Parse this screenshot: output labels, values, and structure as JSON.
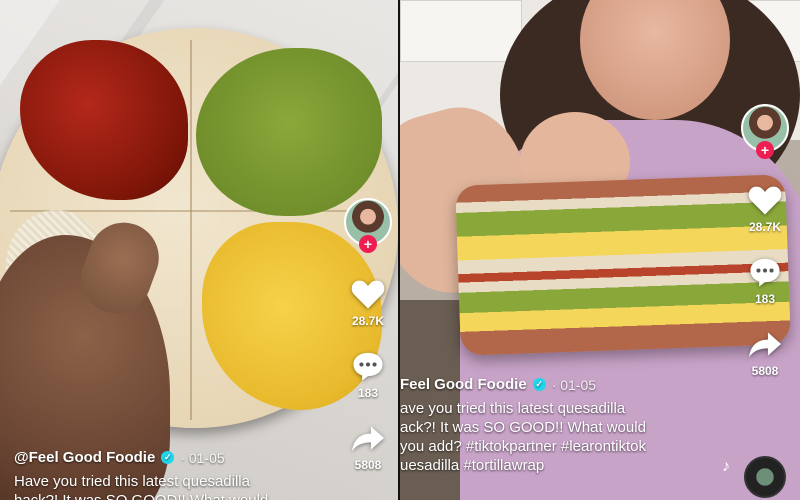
{
  "left": {
    "likes": "28.7K",
    "comments": "183",
    "shares": "5808",
    "username": "@Feel Good Foodie",
    "date": "01-05",
    "caption_line1": "Have you tried this latest quesadilla",
    "caption_line2": "hack?! It was SO GOOD!! What would"
  },
  "right": {
    "likes": "28.7K",
    "comments": "183",
    "shares": "5808",
    "username": "Feel Good Foodie",
    "date": "01-05",
    "caption_line1": "ave you tried this latest quesadilla",
    "caption_line2": "ack?! It was SO GOOD!! What would",
    "caption_line3": "you add? #tiktokpartner #learontiktok",
    "caption_line4": "uesadilla #tortillawrap"
  },
  "icons": [
    "heart-icon",
    "comment-icon",
    "share-icon",
    "verified-badge",
    "music-note-icon",
    "follow-plus-icon"
  ],
  "colors": {
    "accent_red": "#ee1d52",
    "verified_blue": "#20d5ec"
  }
}
